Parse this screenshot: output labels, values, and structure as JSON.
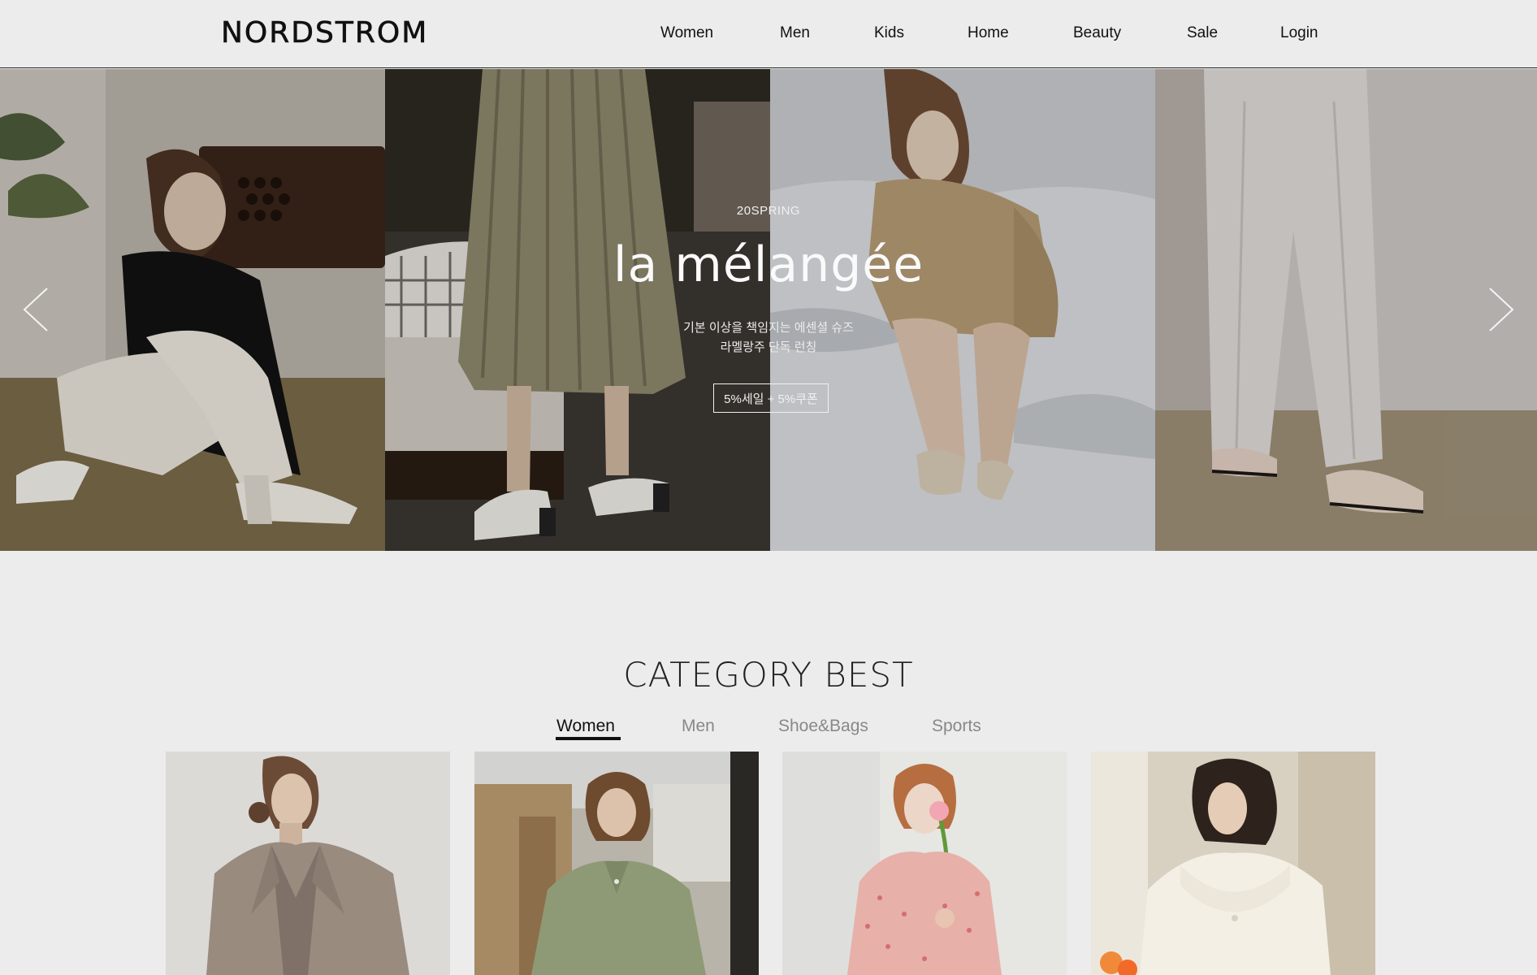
{
  "header": {
    "logo": "NORDSTROM",
    "nav": [
      {
        "label": "Women"
      },
      {
        "label": "Men"
      },
      {
        "label": "Kids"
      },
      {
        "label": "Home"
      },
      {
        "label": "Beauty"
      },
      {
        "label": "Sale"
      },
      {
        "label": "Login"
      }
    ]
  },
  "hero": {
    "eyebrow": "20SPRING",
    "title": "la mélangée",
    "subtitle_line1": "기본 이상을 책임지는 에센셜 슈즈",
    "subtitle_line2": "라멜랑주 단독 런칭",
    "cta": "5%세일 + 5%쿠폰",
    "prev_icon": "chevron-left-icon",
    "next_icon": "chevron-right-icon"
  },
  "category_best": {
    "title": "CATEGORY BEST",
    "tabs": [
      {
        "label": "Women",
        "active": true
      },
      {
        "label": "Men",
        "active": false
      },
      {
        "label": "Shoe&Bags",
        "active": false
      },
      {
        "label": "Sports",
        "active": false
      }
    ]
  },
  "colors": {
    "background": "#ececec",
    "text": "#111111",
    "inactive_tab": "#888888"
  }
}
